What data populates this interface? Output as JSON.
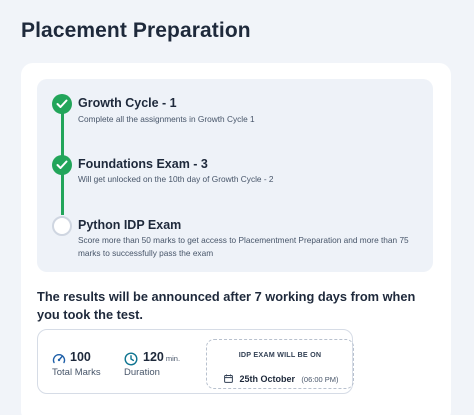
{
  "page": {
    "title": "Placement Preparation"
  },
  "timeline": {
    "steps": [
      {
        "title": "Growth Cycle - 1",
        "description": "Complete all the assignments in Growth Cycle 1",
        "status": "completed"
      },
      {
        "title": "Foundations Exam - 3",
        "description": "Will get unlocked on the 10th day of Growth Cycle - 2",
        "status": "completed"
      },
      {
        "title": "Python IDP Exam",
        "description": "Score more than 50 marks to get access to Placementment Preparation and more than 75 marks to successfully pass the exam",
        "status": "pending"
      }
    ]
  },
  "announcement": "The results will be announced after 7 working days from when you took the test.",
  "exam_info": {
    "total_marks": {
      "value": "100",
      "label": "Total Marks",
      "icon": "gauge-icon"
    },
    "duration": {
      "value": "120",
      "unit": "min.",
      "label": "Duration",
      "icon": "clock-icon"
    },
    "schedule": {
      "heading": "IDP EXAM WILL BE ON",
      "date": "25th October",
      "time": "(06:00 PM)",
      "icon": "calendar-icon"
    }
  },
  "colors": {
    "success": "#22a55a",
    "pending_border": "#cfd6e1",
    "accent": "#0e7490",
    "text": "#1e293b",
    "background": "#f1f4f9"
  }
}
